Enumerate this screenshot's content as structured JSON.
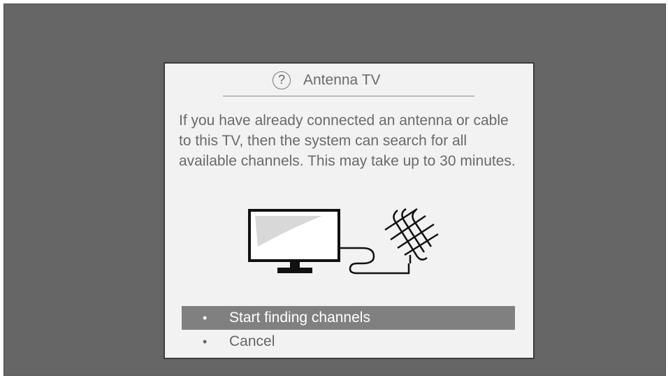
{
  "dialog": {
    "title": "Antenna TV",
    "help_icon": "?",
    "body": "If you have already connected an antenna or cable to this TV, then the system can search for all available channels. This may take up to 30 minutes.",
    "illustration_icons": [
      "tv-icon",
      "cable-icon",
      "antenna-icon"
    ]
  },
  "menu": {
    "bullet": "•",
    "items": [
      {
        "label": "Start finding channels",
        "selected": true
      },
      {
        "label": "Cancel",
        "selected": false
      }
    ]
  },
  "colors": {
    "background": "#666666",
    "dialog_background": "#f2f2f2",
    "selected_item": "#808080",
    "text": "#6a6a6a"
  }
}
